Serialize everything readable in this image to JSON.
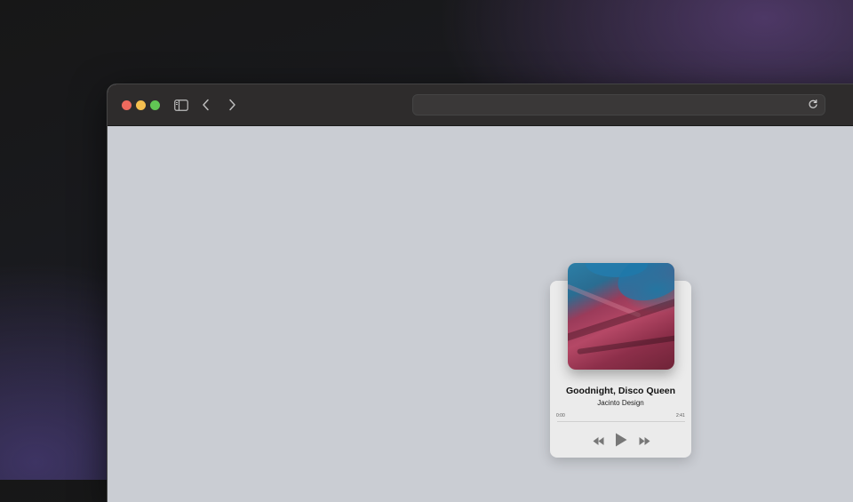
{
  "browser": {
    "address_value": "",
    "address_placeholder": "",
    "icons": {
      "sidebar": "sidebar-icon",
      "back": "chevron-left-icon",
      "forward": "chevron-right-icon",
      "reload": "reload-icon"
    }
  },
  "player": {
    "song_title": "Goodnight, Disco Queen",
    "artist": "Jacinto Design",
    "time_elapsed": "0:00",
    "time_total": "2:41",
    "progress": 0,
    "controls": [
      "rewind-icon",
      "play-icon",
      "fast-forward-icon"
    ]
  },
  "colors": {
    "page_background": "#cacdd3",
    "card_background": "#ebebeb",
    "titlebar": "#2e2c2c"
  }
}
